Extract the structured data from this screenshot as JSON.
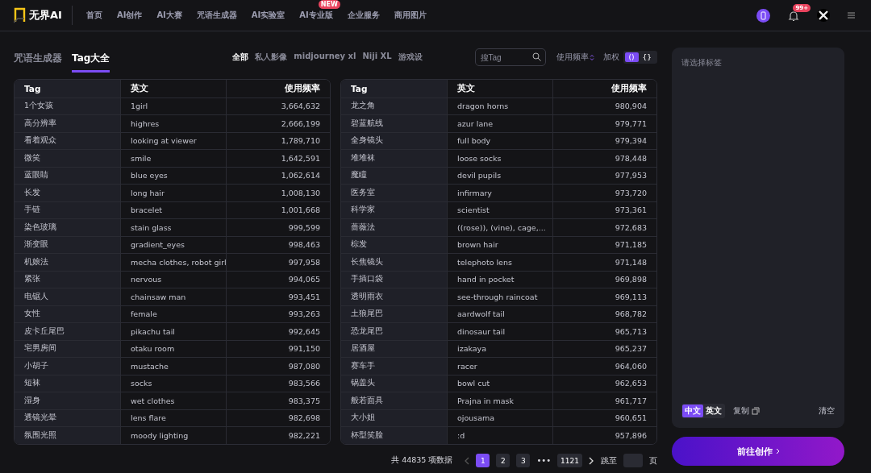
{
  "nav": {
    "logo": "无界AI",
    "items": [
      {
        "label": "首页"
      },
      {
        "label": "AI创作"
      },
      {
        "label": "AI大赛"
      },
      {
        "label": "咒语生成器"
      },
      {
        "label": "AI实验室"
      },
      {
        "label": "AI专业版",
        "badge": "NEW"
      },
      {
        "label": "企业服务"
      },
      {
        "label": "商用图片"
      }
    ],
    "notification_badge": "99+"
  },
  "page_tabs": [
    {
      "label": "咒语生成器",
      "selected": false
    },
    {
      "label": "Tag大全",
      "selected": true
    }
  ],
  "categories": [
    {
      "label": "全部",
      "selected": true
    },
    {
      "label": "私人影像",
      "selected": false
    },
    {
      "label": "midjourney xl",
      "selected": false
    },
    {
      "label": "Niji XL",
      "selected": false
    },
    {
      "label": "游戏设",
      "selected": false
    }
  ],
  "search": {
    "placeholder": "搜Tag"
  },
  "sort": {
    "label": "使用频率"
  },
  "weight": {
    "label": "加权",
    "options": [
      {
        "label": "()",
        "selected": true
      },
      {
        "label": "{}",
        "selected": false
      }
    ]
  },
  "tables": [
    {
      "columns": [
        "Tag",
        "英文",
        "使用频率"
      ],
      "rows": [
        [
          "1个女孩",
          "1girl",
          "3,664,632"
        ],
        [
          "高分辨率",
          "highres",
          "2,666,199"
        ],
        [
          "看着观众",
          "looking at viewer",
          "1,789,710"
        ],
        [
          "微笑",
          "smile",
          "1,642,591"
        ],
        [
          "蓝眼睛",
          "blue eyes",
          "1,062,614"
        ],
        [
          "长发",
          "long hair",
          "1,008,130"
        ],
        [
          "手链",
          "bracelet",
          "1,001,668"
        ],
        [
          "染色玻璃",
          "stain glass",
          "999,599"
        ],
        [
          "渐变眼",
          "gradient_eyes",
          "998,463"
        ],
        [
          "机娘法",
          "mecha clothes, robot girl",
          "997,958"
        ],
        [
          "紧张",
          "nervous",
          "994,065"
        ],
        [
          "电锯人",
          "chainsaw man",
          "993,451"
        ],
        [
          "女性",
          "female",
          "993,263"
        ],
        [
          "皮卡丘尾巴",
          "pikachu tail",
          "992,645"
        ],
        [
          "宅男房间",
          "otaku room",
          "991,150"
        ],
        [
          "小胡子",
          "mustache",
          "987,080"
        ],
        [
          "短袜",
          "socks",
          "983,566"
        ],
        [
          "湿身",
          "wet clothes",
          "983,375"
        ],
        [
          "透镜光晕",
          "lens flare",
          "982,698"
        ],
        [
          "氛围光照",
          "moody lighting",
          "982,221"
        ]
      ]
    },
    {
      "columns": [
        "Tag",
        "英文",
        "使用频率"
      ],
      "rows": [
        [
          "龙之角",
          "dragon horns",
          "980,904"
        ],
        [
          "碧蓝航线",
          "azur lane",
          "979,771"
        ],
        [
          "全身镜头",
          "full body",
          "979,394"
        ],
        [
          "堆堆袜",
          "loose socks",
          "978,448"
        ],
        [
          "魔瞳",
          "devil pupils",
          "977,953"
        ],
        [
          "医务室",
          "infirmary",
          "973,720"
        ],
        [
          "科学家",
          "scientist",
          "973,361"
        ],
        [
          "蔷薇法",
          "((rose)), (vine), cage,...",
          "972,683"
        ],
        [
          "棕发",
          "brown hair",
          "971,185"
        ],
        [
          "长焦镜头",
          "telephoto lens",
          "971,148"
        ],
        [
          "手插口袋",
          "hand in pocket",
          "969,898"
        ],
        [
          "透明雨衣",
          "see-through raincoat",
          "969,113"
        ],
        [
          "土狼尾巴",
          "aardwolf tail",
          "968,782"
        ],
        [
          "恐龙尾巴",
          "dinosaur tail",
          "965,713"
        ],
        [
          "居酒屋",
          "izakaya",
          "965,237"
        ],
        [
          "赛车手",
          "racer",
          "964,060"
        ],
        [
          "锅盖头",
          "bowl cut",
          "962,653"
        ],
        [
          "般若面具",
          "Prajna in mask",
          "961,717"
        ],
        [
          "大小姐",
          "ojousama",
          "960,651"
        ],
        [
          "杯型笑脸",
          ":d",
          "957,896"
        ]
      ]
    }
  ],
  "pagination": {
    "total": "共 44835 项数据",
    "pages": [
      {
        "label": "1",
        "selected": true
      },
      {
        "label": "2",
        "selected": false
      },
      {
        "label": "3",
        "selected": false
      }
    ],
    "ellipsis": "•••",
    "last_page": "1121",
    "goto": "跳至",
    "page_suffix": "页"
  },
  "panel": {
    "placeholder": "请选择标签",
    "languages": [
      {
        "label": "中文",
        "selected": true
      },
      {
        "label": "英文",
        "selected": false
      }
    ],
    "copy": "复制",
    "clear": "清空"
  },
  "cta": {
    "label": "前往创作"
  }
}
